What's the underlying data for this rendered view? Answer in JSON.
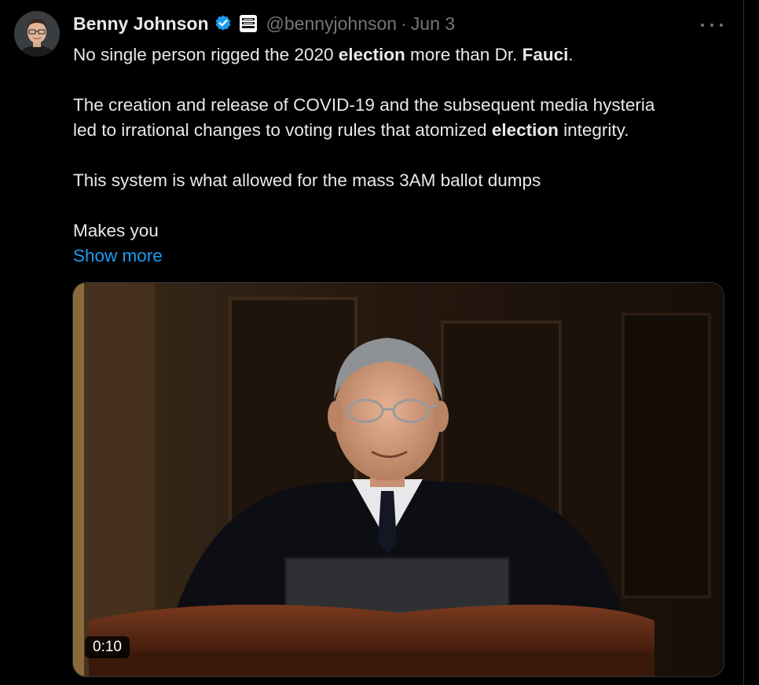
{
  "author": {
    "display_name": "Benny Johnson",
    "handle": "@bennyjohnson",
    "separator": "·",
    "date": "Jun 3",
    "verified_icon": "verified-badge-icon",
    "affiliate_icon": "affiliate-badge-icon"
  },
  "tweet": {
    "p1": {
      "t1": "No single person rigged the 2020 ",
      "b1": "election",
      "t2": " more than Dr. ",
      "b2": "Fauci",
      "t3": "."
    },
    "p2": {
      "line1": "The creation and release of COVID-19 and the subsequent media hysteria",
      "t1": "led to irrational changes to voting rules that atomized ",
      "b1": "election",
      "t2": " integrity."
    },
    "p3": "This system is what allowed for the mass 3AM ballot dumps",
    "p4": "Makes you",
    "show_more": "Show more"
  },
  "media": {
    "duration": "0:10"
  },
  "colors": {
    "background": "#000000",
    "text": "#e7e9ea",
    "secondary": "#71767b",
    "link": "#1d9bf0",
    "verified": "#1d9bf0"
  }
}
